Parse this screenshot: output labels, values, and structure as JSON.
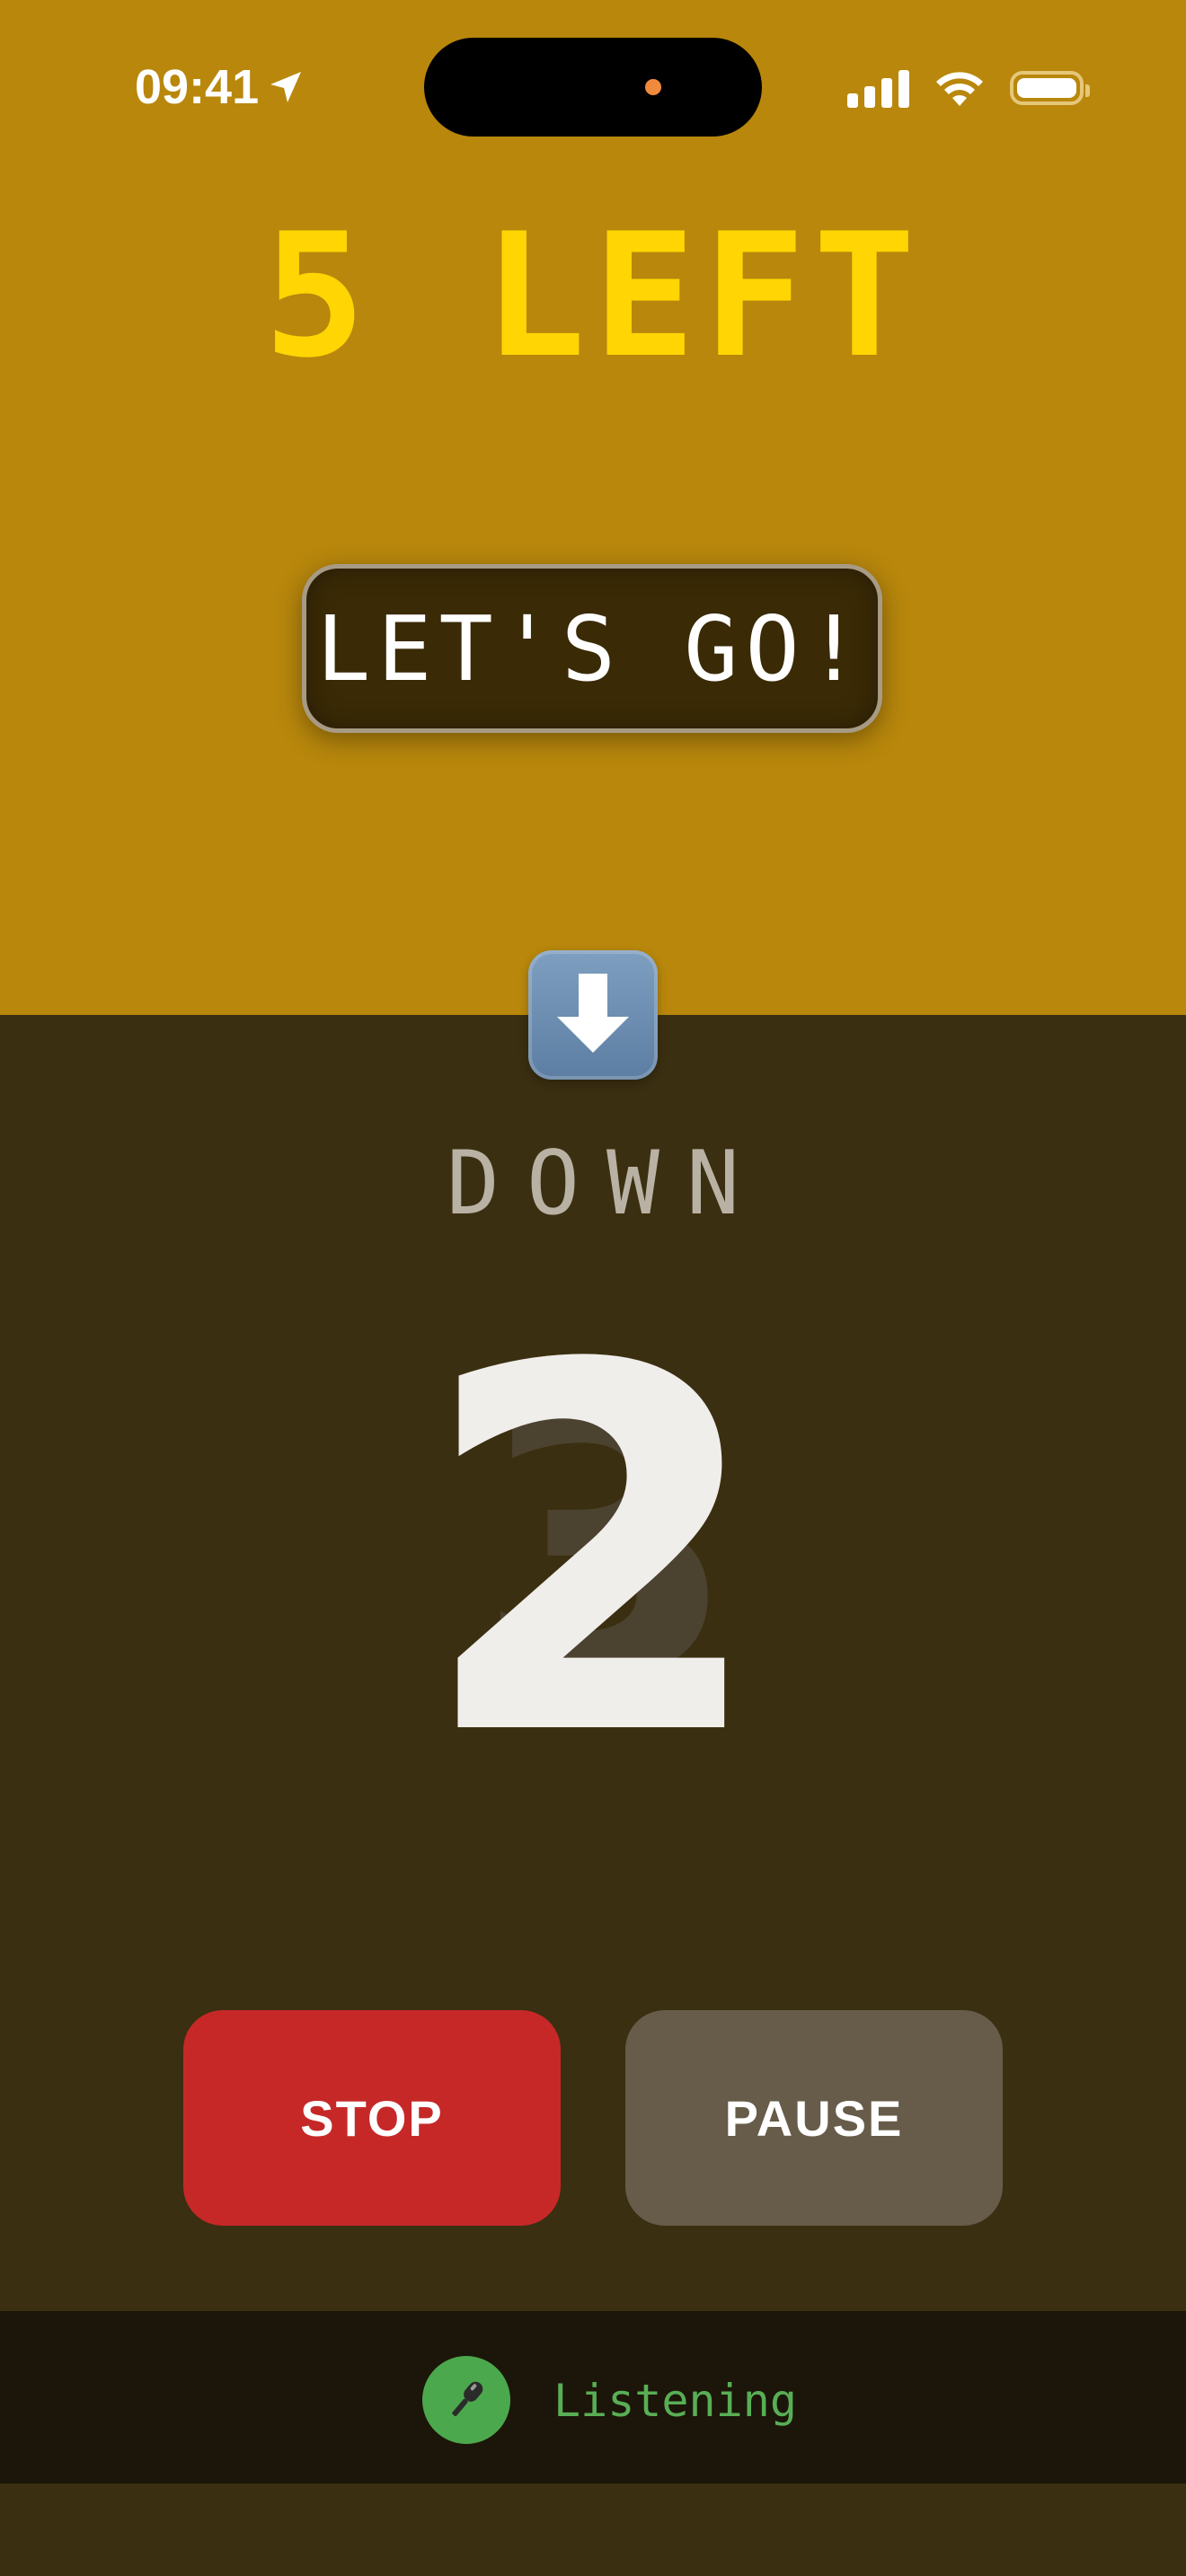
{
  "status_bar": {
    "time": "09:41"
  },
  "counter": {
    "remaining_text": "5 LEFT"
  },
  "prompt": {
    "button_label": "LET'S GO!"
  },
  "movement": {
    "direction_icon": "down-arrow-icon",
    "direction_label": "DOWN",
    "previous_count": "3",
    "current_count": "2"
  },
  "controls": {
    "stop_label": "STOP",
    "pause_label": "PAUSE"
  },
  "voice": {
    "icon": "microphone-icon",
    "status": "Listening"
  },
  "colors": {
    "top_background": "#b8870c",
    "bottom_background": "#3b2f11",
    "counter_text": "#ffd503",
    "stop": "#c62828",
    "pause": "#665c49",
    "listening": "#59ae55"
  }
}
